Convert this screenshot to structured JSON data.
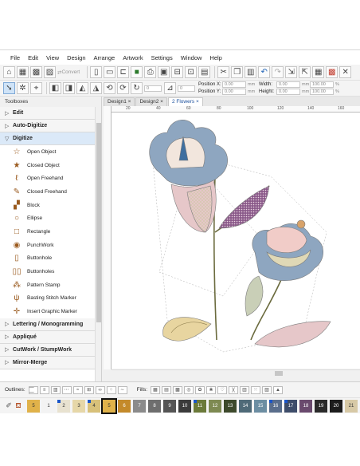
{
  "menu": [
    "File",
    "Edit",
    "View",
    "Design",
    "Arrange",
    "Artwork",
    "Settings",
    "Window",
    "Help"
  ],
  "toolbar": {
    "convert_label": "Convert",
    "position_x_label": "Position X:",
    "position_y_label": "Position Y:",
    "width_label": "Width:",
    "height_label": "Height:",
    "position_x_value": "0.00",
    "position_y_value": "0.00",
    "width_value": "0.00",
    "height_value": "0.00",
    "unit": "mm",
    "scale_x_value": "100.00",
    "scale_y_value": "100.00",
    "percent": "%",
    "rotate_value": "0",
    "skew_value": "0"
  },
  "sidebar": {
    "title": "Toolboxes",
    "sections_top": [
      {
        "label": "Edit",
        "state": "collapsed"
      },
      {
        "label": "Auto-Digitize",
        "state": "collapsed"
      },
      {
        "label": "Digitize",
        "state": "expanded"
      }
    ],
    "tools": [
      {
        "label": "Open Object",
        "icon": "open-object-icon",
        "glyph": "☆"
      },
      {
        "label": "Closed Object",
        "icon": "closed-object-icon",
        "glyph": "★"
      },
      {
        "label": "Open Freehand",
        "icon": "open-freehand-icon",
        "glyph": "ℓ"
      },
      {
        "label": "Closed Freehand",
        "icon": "closed-freehand-icon",
        "glyph": "✎"
      },
      {
        "label": "Block",
        "icon": "block-icon",
        "glyph": "▞"
      },
      {
        "label": "Ellipse",
        "icon": "ellipse-icon",
        "glyph": "○"
      },
      {
        "label": "Rectangle",
        "icon": "rectangle-icon",
        "glyph": "□"
      },
      {
        "label": "PunchWork",
        "icon": "punchwork-icon",
        "glyph": "◉"
      },
      {
        "label": "Buttonhole",
        "icon": "buttonhole-icon",
        "glyph": "▯"
      },
      {
        "label": "Buttonholes",
        "icon": "buttonholes-icon",
        "glyph": "▯▯"
      },
      {
        "label": "Pattern Stamp",
        "icon": "pattern-stamp-icon",
        "glyph": "⁂"
      },
      {
        "label": "Basting Stitch Marker",
        "icon": "basting-stitch-icon",
        "glyph": "ψ"
      },
      {
        "label": "Insert Graphic Marker",
        "icon": "insert-graphic-icon",
        "glyph": "✛"
      }
    ],
    "sections_bottom": [
      {
        "label": "Lettering / Monogramming",
        "state": "collapsed"
      },
      {
        "label": "Appliqué",
        "state": "collapsed"
      },
      {
        "label": "CutWork / StumpWork",
        "state": "collapsed"
      },
      {
        "label": "Mirror-Merge",
        "state": "collapsed"
      }
    ]
  },
  "tabs": [
    {
      "label": "Design1",
      "close": "×",
      "active": false
    },
    {
      "label": "Design2",
      "close": "×",
      "active": false
    },
    {
      "label": "2 Flowers",
      "close": "×",
      "active": true
    }
  ],
  "ruler_ticks": [
    "20",
    "40",
    "60",
    "80",
    "100",
    "120",
    "140",
    "160"
  ],
  "bottom": {
    "outlines_label": "Outlines:",
    "fills_label": "Fills:",
    "chips": [
      {
        "label": "5",
        "color": "#e0b24a",
        "marked": false,
        "selected": false
      },
      {
        "label": "1",
        "color": "#f3f3f3",
        "marked": false,
        "selected": false
      },
      {
        "label": "2",
        "color": "#e8e2d0",
        "marked": true,
        "selected": false
      },
      {
        "label": "3",
        "color": "#e6d7a8",
        "marked": false,
        "selected": false
      },
      {
        "label": "4",
        "color": "#d8c17a",
        "marked": true,
        "selected": false
      },
      {
        "label": "5",
        "color": "#e0b24a",
        "marked": false,
        "selected": true
      },
      {
        "label": "6",
        "color": "#c48a2a",
        "marked": false,
        "selected": false
      },
      {
        "label": "7",
        "color": "#8b8b8b",
        "marked": false,
        "selected": false
      },
      {
        "label": "8",
        "color": "#6e6e6e",
        "marked": false,
        "selected": false
      },
      {
        "label": "9",
        "color": "#555555",
        "marked": false,
        "selected": false
      },
      {
        "label": "10",
        "color": "#3b3b3b",
        "marked": false,
        "selected": false
      },
      {
        "label": "11",
        "color": "#6b7a3a",
        "marked": true,
        "selected": false
      },
      {
        "label": "12",
        "color": "#7e8a52",
        "marked": false,
        "selected": false
      },
      {
        "label": "13",
        "color": "#3d4a2c",
        "marked": false,
        "selected": false
      },
      {
        "label": "14",
        "color": "#4f6a78",
        "marked": false,
        "selected": false
      },
      {
        "label": "15",
        "color": "#6c8ea2",
        "marked": false,
        "selected": false
      },
      {
        "label": "16",
        "color": "#5a6e8c",
        "marked": true,
        "selected": false
      },
      {
        "label": "17",
        "color": "#3e4d6a",
        "marked": true,
        "selected": false
      },
      {
        "label": "18",
        "color": "#6a4a6e",
        "marked": false,
        "selected": false
      },
      {
        "label": "19",
        "color": "#2a2a2a",
        "marked": false,
        "selected": false
      },
      {
        "label": "20",
        "color": "#1c1c1c",
        "marked": false,
        "selected": false
      },
      {
        "label": "21",
        "color": "#d7c9a6",
        "marked": false,
        "selected": false
      }
    ]
  }
}
